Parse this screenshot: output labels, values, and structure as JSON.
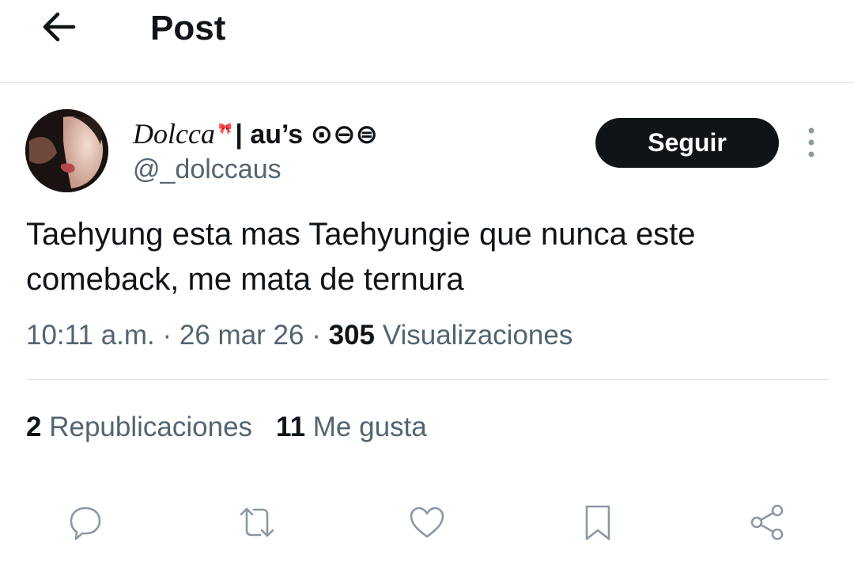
{
  "header": {
    "title": "Post",
    "back_icon": "arrow-left-icon"
  },
  "author": {
    "name_script": "Dolcca",
    "name_rest": "| au’s ⊙⊖⊜",
    "ribbon": "🎀",
    "handle": "@_dolccaus",
    "follow_label": "Seguir"
  },
  "tweet": {
    "text": "Taehyung esta mas Taehyungie que nunca este comeback, me mata de ternura",
    "time": "10:11 a.m.",
    "sep1": " · ",
    "date": "26 mar 26",
    "sep2": " · ",
    "views_count": "305",
    "views_label": "Visualizaciones"
  },
  "stats": {
    "reposts_count": "2",
    "reposts_label": "Republicaciones",
    "likes_count": "11",
    "likes_label": "Me gusta"
  },
  "actions": [
    "reply-icon",
    "repost-icon",
    "like-icon",
    "bookmark-icon",
    "share-icon"
  ],
  "colors": {
    "text": "#0f1419",
    "secondary": "#536471",
    "icon": "#8b98a5",
    "divider": "#e1e4e6",
    "button": "#0f1419"
  }
}
